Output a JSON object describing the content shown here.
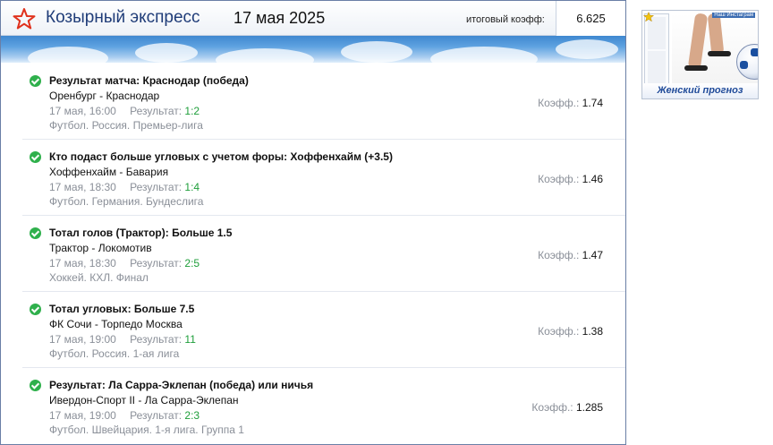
{
  "header": {
    "brand": "Козырный экспресс",
    "date": "17 мая 2025",
    "total_coef_label": "итоговый коэфф:",
    "total_coef_value": "6.625",
    "logo_icon": "star-icon",
    "accent_color": "#e0311c"
  },
  "bets": [
    {
      "title": "Результат матча: Краснодар (победа)",
      "teams": "Оренбург - Краснодар",
      "datetime": "17 мая, 16:00",
      "result_label": "Результат:",
      "score": "1:2",
      "league": "Футбол. Россия. Премьер-лига",
      "odds_label": "Коэфф.:",
      "odds": "1.74",
      "status_icon": "check-circle-icon"
    },
    {
      "title": "Кто подаст больше угловых с учетом форы: Хоффенхайм (+3.5)",
      "teams": "Хоффенхайм - Бавария",
      "datetime": "17 мая, 18:30",
      "result_label": "Результат:",
      "score": "1:4",
      "league": "Футбол. Германия. Бундеслига",
      "odds_label": "Коэфф.:",
      "odds": "1.46",
      "status_icon": "check-circle-icon"
    },
    {
      "title": "Тотал голов (Трактор): Больше 1.5",
      "teams": "Трактор - Локомотив",
      "datetime": "17 мая, 18:30",
      "result_label": "Результат:",
      "score": "2:5",
      "league": "Хоккей. КХЛ. Финал",
      "odds_label": "Коэфф.:",
      "odds": "1.47",
      "status_icon": "check-circle-icon"
    },
    {
      "title": "Тотал угловых: Больше 7.5",
      "teams": "ФК Сочи - Торпедо Москва",
      "datetime": "17 мая, 19:00",
      "result_label": "Результат:",
      "score": "11",
      "league": "Футбол. Россия. 1-ая лига",
      "odds_label": "Коэфф.:",
      "odds": "1.38",
      "status_icon": "check-circle-icon"
    },
    {
      "title": "Результат: Ла Сарра-Эклепан (победа) или ничья",
      "teams": "Ивердон-Спорт II - Ла Сарра-Эклепан",
      "datetime": "17 мая, 19:00",
      "result_label": "Результат:",
      "score": "2:3",
      "league": "Футбол. Швейцария. 1-я лига. Группа 1",
      "odds_label": "Коэфф.:",
      "odds": "1.285",
      "status_icon": "check-circle-icon"
    }
  ],
  "banner": {
    "caption": "Женский прогноз",
    "tag": "Наш Инстаграм",
    "icon": "star-icon"
  }
}
